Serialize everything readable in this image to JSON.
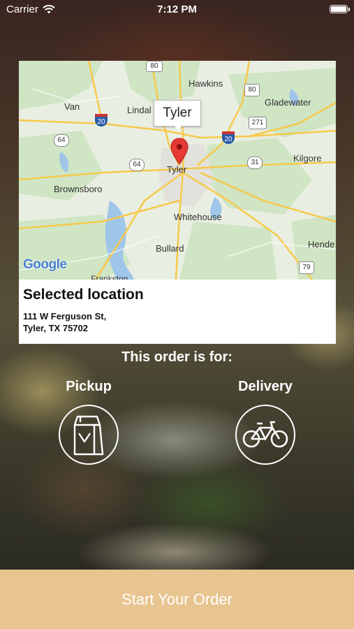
{
  "status_bar": {
    "carrier": "Carrier",
    "time": "7:12 PM"
  },
  "map": {
    "callout": "Tyler",
    "attribution": "Google",
    "places": {
      "hawkins": "Hawkins",
      "van": "Van",
      "lindale": "Lindal",
      "gladewater": "Gladewater",
      "tyler": "Tyler",
      "kilgore": "Kilgore",
      "brownsboro": "Brownsboro",
      "whitehouse": "Whitehouse",
      "bullard": "Bullard",
      "henderson": "Hende",
      "frankston": "Frankston"
    },
    "shields": {
      "r80a": "80",
      "r80b": "80",
      "i20a": "20",
      "i20b": "20",
      "r271": "271",
      "r64a": "64",
      "r64b": "64",
      "r31": "31",
      "r79": "79"
    }
  },
  "location": {
    "title": "Selected location",
    "address_line1": "111 W Ferguson St,",
    "address_line2": "Tyler, TX 75702"
  },
  "order": {
    "heading": "This order is for:",
    "pickup_label": "Pickup",
    "delivery_label": "Delivery"
  },
  "cta": {
    "label": "Start Your Order",
    "color": "#e8c590"
  }
}
